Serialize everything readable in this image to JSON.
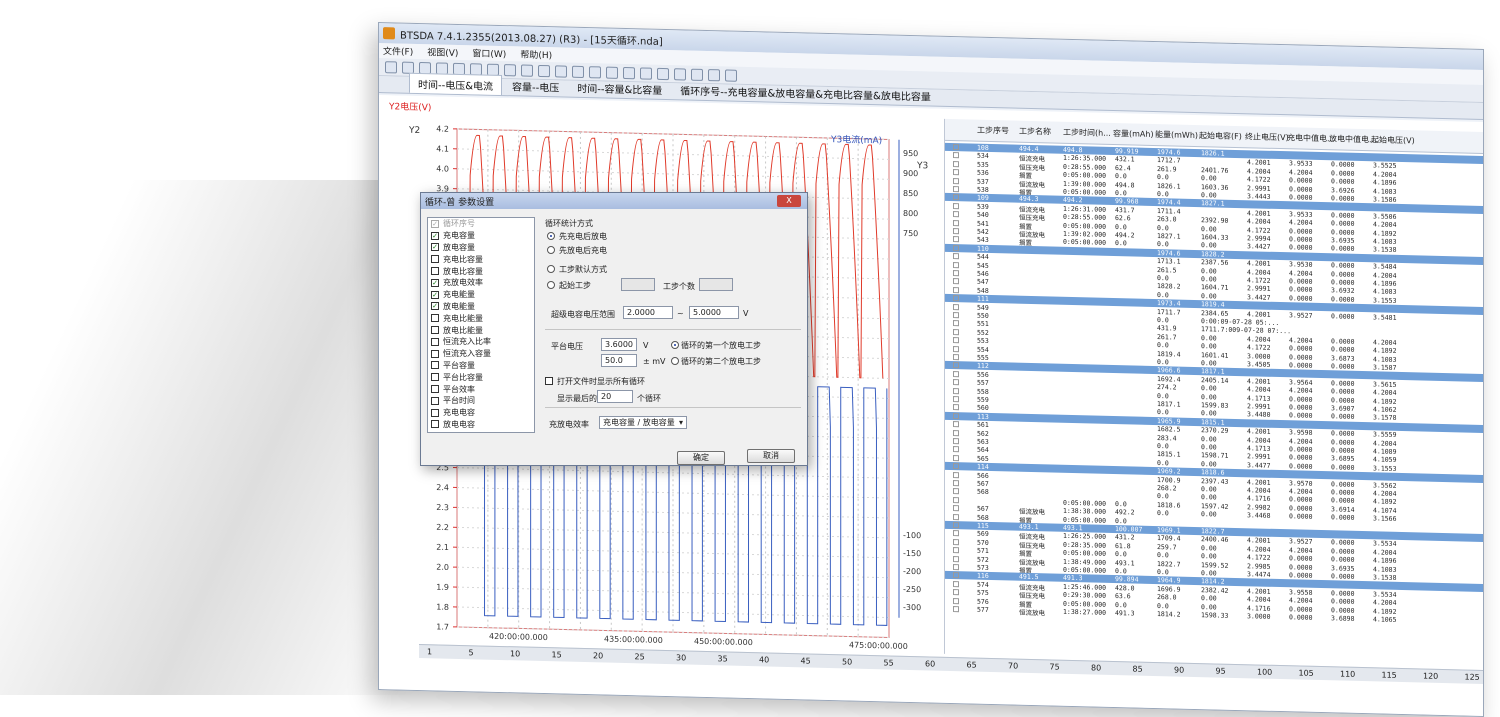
{
  "app": {
    "title": "BTSDA 7.4.1.2355(2013.08.27) (R3) - [15天循环.nda]"
  },
  "menu": [
    "文件(F)",
    "视图(V)",
    "窗口(W)",
    "帮助(H)"
  ],
  "tabs": [
    "时间--电压&电流",
    "容量--电压",
    "时间--容量&比容量",
    "循环序号--充电容量&放电容量&充电比容量&放电比容量"
  ],
  "chart": {
    "y2_title": "Y2电压(V)",
    "y2_label": "Y2",
    "y3_label": "Y3",
    "y3_title": "Y3电流(mA)",
    "x_title": "时间",
    "x_unit": "(h:min:s.ms)",
    "x_label": "X",
    "y2_ticks": [
      "4.2",
      "4.1",
      "4.0",
      "3.9",
      "3.8",
      "3.7",
      "3.6",
      "3.5",
      "3.4",
      "3.3",
      "3.2",
      "3.1",
      "3.0",
      "2.9",
      "2.8",
      "2.7",
      "2.6",
      "2.5",
      "2.4",
      "2.3",
      "2.2",
      "2.1",
      "2.0",
      "1.9",
      "1.8",
      "1.7"
    ],
    "y3_ticks": [
      "950",
      "900",
      "850",
      "800",
      "750",
      "-100",
      "-150",
      "-200",
      "-250",
      "-300"
    ],
    "x_ticks": [
      "420:00:00.000",
      "435:00:00.000",
      "450:00:00.000",
      "475:00:00.000"
    ]
  },
  "chart_data": {
    "type": "line",
    "x_ticks": [
      "420:00:00.000",
      "435:00:00.000",
      "450:00:00.000",
      "475:00:00.000"
    ],
    "series": [
      {
        "name": "Y2电压(V)",
        "color": "#e03a2a",
        "values": [
          4.2,
          3.0,
          4.2,
          3.0,
          4.2,
          3.0,
          4.2,
          3.0,
          4.2,
          3.0,
          4.2,
          3.0,
          4.2,
          3.0,
          4.2,
          3.0,
          4.2,
          3.0,
          4.2,
          3.0,
          4.2,
          3.0,
          4.2,
          3.0,
          4.2,
          3.0,
          4.2,
          3.0,
          4.2,
          3.0,
          4.2,
          3.0,
          4.2,
          3.0,
          4.2,
          3.0
        ]
      },
      {
        "name": "Y3电流(mA)",
        "color": "#3a5fc0",
        "values": [
          950,
          -300,
          950,
          -300,
          950,
          -300,
          950,
          -300,
          950,
          -300,
          950,
          -300,
          950,
          -300,
          950,
          -300,
          950,
          -300,
          950,
          -300,
          950,
          -300,
          950,
          -300,
          950,
          -300,
          950,
          -300,
          950,
          -300,
          950,
          -300,
          950,
          -300,
          950,
          -300
        ]
      }
    ],
    "cycles": 18,
    "y2_range": [
      1.7,
      4.2
    ],
    "grid": true
  },
  "table": {
    "headers": [
      "工步序号",
      "工步名称",
      "工步时间(h...",
      "容量(mAh)",
      "能量(mWh)",
      "起始电容(F)",
      "终止电压(V)",
      "充电中值电...",
      "放电中值电...",
      "起始电压(V)"
    ],
    "rows": [
      {
        "cyc": true,
        "c": [
          "108",
          "494.4",
          "494.8",
          "99.919",
          "1974.6",
          "1826.1",
          "",
          "",
          "",
          ""
        ]
      },
      {
        "c": [
          "534",
          "恒流充电",
          "1:26:35.000",
          "432.1",
          "1712.7",
          "",
          "4.2001",
          "3.9533",
          "0.0000",
          "3.5525"
        ]
      },
      {
        "c": [
          "535",
          "恒压充电",
          "0:28:55.000",
          "62.4",
          "261.9",
          "2401.76",
          "4.2004",
          "4.2004",
          "0.0000",
          "4.2004"
        ]
      },
      {
        "c": [
          "536",
          "搁置",
          "0:05:00.000",
          "0.0",
          "0.0",
          "0.00",
          "4.1722",
          "0.0000",
          "0.0000",
          "4.1896"
        ]
      },
      {
        "c": [
          "537",
          "恒流放电",
          "1:39:00.000",
          "494.8",
          "1826.1",
          "1603.36",
          "2.9991",
          "0.0000",
          "3.6926",
          "4.1083"
        ]
      },
      {
        "c": [
          "538",
          "搁置",
          "0:05:00.000",
          "0.0",
          "0.0",
          "0.00",
          "3.4443",
          "0.0000",
          "0.0000",
          "3.1586"
        ]
      },
      {
        "cyc": true,
        "c": [
          "109",
          "494.3",
          "494.2",
          "99.968",
          "1974.4",
          "1827.1",
          "",
          "",
          "",
          ""
        ]
      },
      {
        "c": [
          "539",
          "恒流充电",
          "1:26:31.000",
          "431.7",
          "1711.4",
          "",
          "4.2001",
          "3.9533",
          "0.0000",
          "3.5506"
        ]
      },
      {
        "c": [
          "540",
          "恒压充电",
          "0:28:55.000",
          "62.6",
          "263.0",
          "2392.90",
          "4.2004",
          "4.2004",
          "0.0000",
          "4.2004"
        ]
      },
      {
        "c": [
          "541",
          "搁置",
          "0:05:00.000",
          "0.0",
          "0.0",
          "0.00",
          "4.1722",
          "0.0000",
          "0.0000",
          "4.1892"
        ]
      },
      {
        "c": [
          "542",
          "恒流放电",
          "1:39:02.000",
          "494.2",
          "1827.1",
          "1604.33",
          "2.9994",
          "0.0000",
          "3.6935",
          "4.1083"
        ]
      },
      {
        "c": [
          "543",
          "搁置",
          "0:05:00.000",
          "0.0",
          "0.0",
          "0.00",
          "3.4427",
          "0.0000",
          "0.0000",
          "3.1538"
        ]
      },
      {
        "cyc": true,
        "c": [
          "110",
          "",
          "",
          "",
          "1974.6",
          "1828.2",
          "",
          "",
          "",
          ""
        ]
      },
      {
        "c": [
          "544",
          "",
          "",
          "",
          "1713.1",
          "2387.56",
          "4.2001",
          "3.9530",
          "0.0000",
          "3.5484"
        ]
      },
      {
        "c": [
          "545",
          "",
          "",
          "",
          "261.5",
          "0.00",
          "4.2004",
          "4.2004",
          "0.0000",
          "4.2004"
        ]
      },
      {
        "c": [
          "546",
          "",
          "",
          "",
          "0.0",
          "0.00",
          "4.1722",
          "0.0000",
          "0.0000",
          "4.1896"
        ]
      },
      {
        "c": [
          "547",
          "",
          "",
          "",
          "1828.2",
          "1604.71",
          "2.9991",
          "0.0000",
          "3.6932",
          "4.1083"
        ]
      },
      {
        "c": [
          "548",
          "",
          "",
          "",
          "0.0",
          "0.00",
          "3.4427",
          "0.0000",
          "0.0000",
          "3.1553"
        ]
      },
      {
        "cyc": true,
        "c": [
          "111",
          "",
          "",
          "",
          "1973.4",
          "1819.4",
          "",
          "",
          "",
          ""
        ]
      },
      {
        "c": [
          "549",
          "",
          "",
          "",
          "1711.7",
          "2384.65",
          "4.2001",
          "3.9527",
          "0.0000",
          "3.5481"
        ]
      },
      {
        "c": [
          "550",
          "",
          "",
          "",
          "0.0",
          "0:00:09-07-28 05:...",
          "",
          "",
          "",
          ""
        ]
      },
      {
        "c": [
          "551",
          "",
          "",
          "",
          "431.9",
          "1711.7:009-07-28 07:...",
          "",
          "",
          "",
          ""
        ]
      },
      {
        "c": [
          "552",
          "",
          "",
          "",
          "261.7",
          "0.00",
          "4.2004",
          "4.2004",
          "0.0000",
          "4.2004"
        ]
      },
      {
        "c": [
          "553",
          "",
          "",
          "",
          "0.0",
          "0.00",
          "4.1722",
          "0.0000",
          "0.0000",
          "4.1892"
        ]
      },
      {
        "c": [
          "554",
          "",
          "",
          "",
          "1819.4",
          "1601.41",
          "3.0000",
          "0.0000",
          "3.6873",
          "4.1083"
        ]
      },
      {
        "c": [
          "555",
          "",
          "",
          "",
          "0.0",
          "0.00",
          "3.4505",
          "0.0000",
          "0.0000",
          "3.1587"
        ]
      },
      {
        "cyc": true,
        "c": [
          "112",
          "",
          "",
          "",
          "1966.6",
          "1817.1",
          "",
          "",
          "",
          ""
        ]
      },
      {
        "c": [
          "556",
          "",
          "",
          "",
          "1692.4",
          "2405.14",
          "4.2001",
          "3.9564",
          "0.0000",
          "3.5615"
        ]
      },
      {
        "c": [
          "557",
          "",
          "",
          "",
          "274.2",
          "0.00",
          "4.2004",
          "4.2004",
          "0.0000",
          "4.2004"
        ]
      },
      {
        "c": [
          "558",
          "",
          "",
          "",
          "0.0",
          "0.00",
          "4.1713",
          "0.0000",
          "0.0000",
          "4.1892"
        ]
      },
      {
        "c": [
          "559",
          "",
          "",
          "",
          "1817.1",
          "1599.83",
          "2.9991",
          "0.0000",
          "3.6907",
          "4.1062"
        ]
      },
      {
        "c": [
          "560",
          "",
          "",
          "",
          "0.0",
          "0.00",
          "3.4480",
          "0.0000",
          "0.0000",
          "3.1578"
        ]
      },
      {
        "cyc": true,
        "c": [
          "113",
          "",
          "",
          "",
          "1965.9",
          "1815.1",
          "",
          "",
          "",
          ""
        ]
      },
      {
        "c": [
          "561",
          "",
          "",
          "",
          "1682.5",
          "2370.29",
          "4.2001",
          "3.9598",
          "0.0000",
          "3.5559"
        ]
      },
      {
        "c": [
          "562",
          "",
          "",
          "",
          "283.4",
          "0.00",
          "4.2004",
          "4.2004",
          "0.0000",
          "4.2004"
        ]
      },
      {
        "c": [
          "563",
          "",
          "",
          "",
          "0.0",
          "0.00",
          "4.1713",
          "0.0000",
          "0.0000",
          "4.1089"
        ]
      },
      {
        "c": [
          "564",
          "",
          "",
          "",
          "1815.1",
          "1598.71",
          "2.9991",
          "0.0000",
          "3.6895",
          "4.1059"
        ]
      },
      {
        "c": [
          "565",
          "",
          "",
          "",
          "0.0",
          "0.00",
          "3.4477",
          "0.0000",
          "0.0000",
          "3.1553"
        ]
      },
      {
        "cyc": true,
        "c": [
          "114",
          "",
          "",
          "",
          "1969.2",
          "1818.6",
          "",
          "",
          "",
          ""
        ]
      },
      {
        "c": [
          "566",
          "",
          "",
          "",
          "1700.9",
          "2397.43",
          "4.2001",
          "3.9570",
          "0.0000",
          "3.5562"
        ]
      },
      {
        "c": [
          "567",
          "",
          "",
          "",
          "268.2",
          "0.00",
          "4.2004",
          "4.2004",
          "0.0000",
          "4.2004"
        ]
      },
      {
        "c": [
          "568",
          "",
          "",
          "",
          "0.0",
          "0.00",
          "4.1716",
          "0.0000",
          "0.0000",
          "4.1892"
        ]
      },
      {
        "c": [
          "",
          "",
          "0:05:00.000",
          "0.0",
          "1818.6",
          "1597.42",
          "2.9982",
          "0.0000",
          "3.6914",
          "4.1074"
        ]
      },
      {
        "c": [
          "567",
          "恒流放电",
          "1:38:38.000",
          "492.2",
          "0.0",
          "0.00",
          "3.4468",
          "0.0000",
          "0.0000",
          "3.1566"
        ]
      },
      {
        "c": [
          "568",
          "搁置",
          "0:05:00.000",
          "0.0",
          "",
          "",
          "",
          "",
          "",
          ""
        ]
      },
      {
        "cyc": true,
        "c": [
          "115",
          "493.1",
          "493.1",
          "100.007",
          "1969.1",
          "1822.7",
          "",
          "",
          "",
          ""
        ]
      },
      {
        "c": [
          "569",
          "恒流充电",
          "1:26:25.000",
          "431.2",
          "1709.4",
          "2400.46",
          "4.2001",
          "3.9527",
          "0.0000",
          "3.5534"
        ]
      },
      {
        "c": [
          "570",
          "恒压充电",
          "0:28:35.000",
          "61.8",
          "259.7",
          "0.00",
          "4.2004",
          "4.2004",
          "0.0000",
          "4.2004"
        ]
      },
      {
        "c": [
          "571",
          "搁置",
          "0:05:00.000",
          "0.0",
          "0.0",
          "0.00",
          "4.1722",
          "0.0000",
          "0.0000",
          "4.1896"
        ]
      },
      {
        "c": [
          "572",
          "恒流放电",
          "1:38:49.000",
          "493.1",
          "1822.7",
          "1599.52",
          "2.9985",
          "0.0000",
          "3.6935",
          "4.1083"
        ]
      },
      {
        "c": [
          "573",
          "搁置",
          "0:05:00.000",
          "0.0",
          "0.0",
          "0.00",
          "3.4474",
          "0.0000",
          "0.0000",
          "3.1538"
        ]
      },
      {
        "cyc": true,
        "c": [
          "116",
          "491.5",
          "491.3",
          "99.894",
          "1964.9",
          "1814.2",
          "",
          "",
          "",
          ""
        ]
      },
      {
        "c": [
          "574",
          "恒流充电",
          "1:25:46.000",
          "428.0",
          "1696.9",
          "2382.42",
          "4.2001",
          "3.9558",
          "0.0000",
          "3.5534"
        ]
      },
      {
        "c": [
          "575",
          "恒压充电",
          "0:29:30.000",
          "63.6",
          "268.0",
          "0.00",
          "4.2004",
          "4.2004",
          "0.0000",
          "4.2004"
        ]
      },
      {
        "c": [
          "576",
          "搁置",
          "0:05:00.000",
          "0.0",
          "0.0",
          "0.00",
          "4.1716",
          "0.0000",
          "0.0000",
          "4.1892"
        ]
      },
      {
        "c": [
          "577",
          "恒流放电",
          "1:38:27.000",
          "491.3",
          "1814.2",
          "1598.33",
          "3.0000",
          "0.0000",
          "3.6898",
          "4.1065"
        ]
      }
    ]
  },
  "bottom_axis": [
    "1",
    "5",
    "10",
    "15",
    "20",
    "25",
    "30",
    "35",
    "40",
    "45",
    "50",
    "55",
    "60",
    "65",
    "70",
    "75",
    "80",
    "85",
    "90",
    "95",
    "100",
    "105",
    "110",
    "115",
    "120",
    "125"
  ],
  "dialog": {
    "title": "循环-曾 参数设置",
    "close_label": "X",
    "list": [
      {
        "label": "循环序号",
        "checked": true,
        "disabled": true
      },
      {
        "label": "充电容量",
        "checked": true
      },
      {
        "label": "放电容量",
        "checked": true
      },
      {
        "label": "充电比容量",
        "checked": false
      },
      {
        "label": "放电比容量",
        "checked": false
      },
      {
        "label": "充放电效率",
        "checked": true
      },
      {
        "label": "充电能量",
        "checked": true
      },
      {
        "label": "放电能量",
        "checked": true
      },
      {
        "label": "充电比能量",
        "checked": false
      },
      {
        "label": "放电比能量",
        "checked": false
      },
      {
        "label": "恒流充入比率",
        "checked": false
      },
      {
        "label": "恒流充入容量",
        "checked": false
      },
      {
        "label": "平台容量",
        "checked": false
      },
      {
        "label": "平台比容量",
        "checked": false
      },
      {
        "label": "平台效率",
        "checked": false
      },
      {
        "label": "平台时间",
        "checked": false
      },
      {
        "label": "充电电容",
        "checked": false
      },
      {
        "label": "放电电容",
        "checked": false
      }
    ],
    "stat_group": "循环统计方式",
    "opt1": "先充电后放电",
    "opt2": "先放电后充电",
    "opt3": "工步默认方式",
    "opt4": "起始工步",
    "step_count_label": "工步个数",
    "supercap_label": "超级电容电压范围",
    "supercap_min": "2.0000",
    "tilde": "~",
    "supercap_max": "5.0000",
    "v_unit": "V",
    "plateau_label": "平台电压",
    "plateau_value": "3.6000",
    "plateau_unit": "V",
    "plateau_delta": "50.0",
    "delta_unit": "± mV",
    "plat_opt1": "循环的第一个放电工步",
    "plat_opt2": "循环的第二个放电工步",
    "show_all_label": "打开文件时显示所有循环",
    "show_last_prefix": "显示最后的",
    "show_last_value": "20",
    "show_last_suffix": "个循环",
    "eff_label": "充放电效率",
    "eff_value": "充电容量 / 放电容量",
    "ok_label": "确定",
    "cancel_label": "取消"
  }
}
